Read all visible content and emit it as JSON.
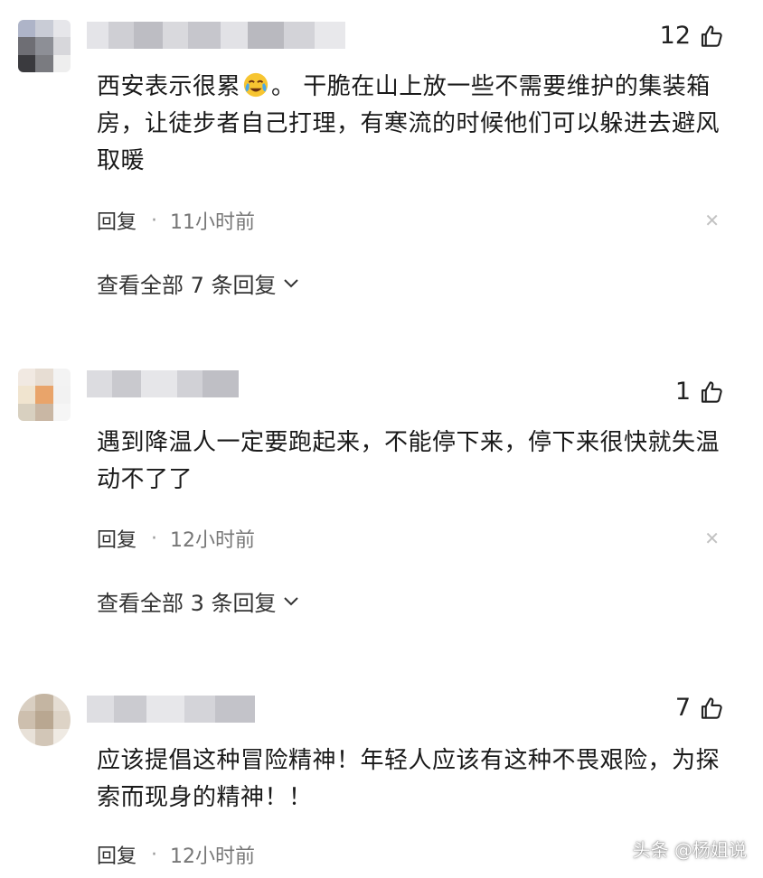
{
  "comments": [
    {
      "likes": "12",
      "text_before_emoji": "西安表示很累",
      "emoji": "crying-laughing-emoji",
      "text_after_emoji": "。 干脆在山上放一些不需要维护的集装箱房，让徒步者自己打理，有寒流的时候他们可以躲进去避风取暖",
      "reply_label": "回复",
      "separator": "·",
      "time": "11小时前",
      "view_replies": "查看全部 7 条回复"
    },
    {
      "likes": "1",
      "text": "遇到降温人一定要跑起来，不能停下来，停下来很快就失温动不了了",
      "reply_label": "回复",
      "separator": "·",
      "time": "12小时前",
      "view_replies": "查看全部 3 条回复"
    },
    {
      "likes": "7",
      "text": "应该提倡这种冒险精神！年轻人应该有这种不畏艰险，为探索而现身的精神！！",
      "reply_label": "回复",
      "separator": "·",
      "time": "12小时前"
    }
  ],
  "watermark": "头条 @杨姐说",
  "colors": {
    "background": "#ffffff",
    "text": "#1a1a1a",
    "meta": "#777777"
  }
}
